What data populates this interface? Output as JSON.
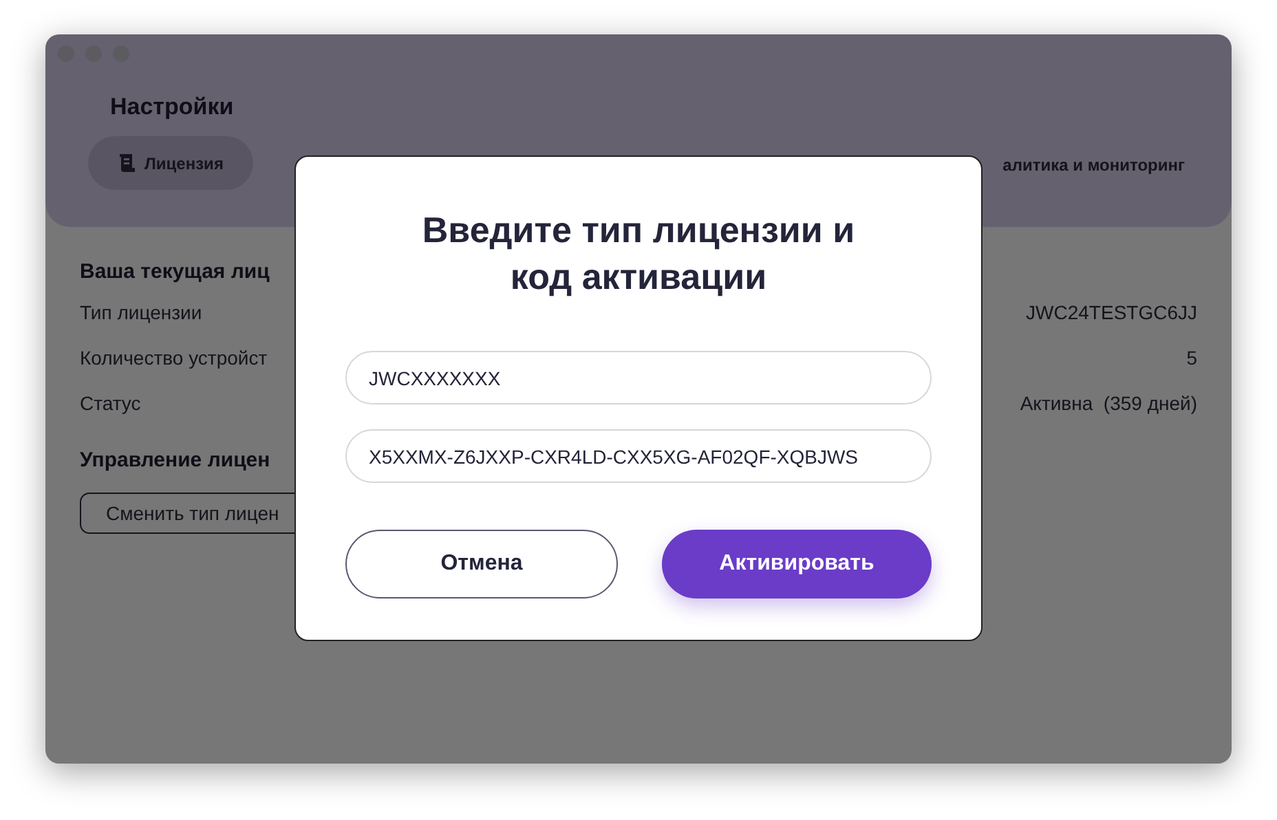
{
  "window": {
    "title": "Настройки"
  },
  "tabs": [
    {
      "label": "Лицензия",
      "selected": true,
      "icon": true
    },
    {
      "label": "алитика и мониторинг",
      "selected": false,
      "icon": false
    }
  ],
  "license": {
    "heading": "Ваша текущая лиц",
    "rows": [
      {
        "label": "Тип лицензии",
        "value": "JWC24TESTGC6JJ"
      },
      {
        "label": "Количество устройст",
        "value": "5"
      },
      {
        "label": "Статус",
        "value": "Активна  (359 дней)"
      }
    ]
  },
  "management": {
    "heading": "Управление лицен",
    "button": "Сменить тип лицен"
  },
  "dialog": {
    "title": "Введите тип лицензии и код активации",
    "license_type": {
      "value": "JWCXXXXXXX"
    },
    "activation_code": {
      "value": "X5XXMX-Z6JXXP-CXR4LD-CXX5XG-AF02QF-XQBJWS"
    },
    "buttons": [
      {
        "label": "Отмена",
        "kind": "secondary"
      },
      {
        "label": "Активировать",
        "kind": "primary"
      }
    ]
  }
}
